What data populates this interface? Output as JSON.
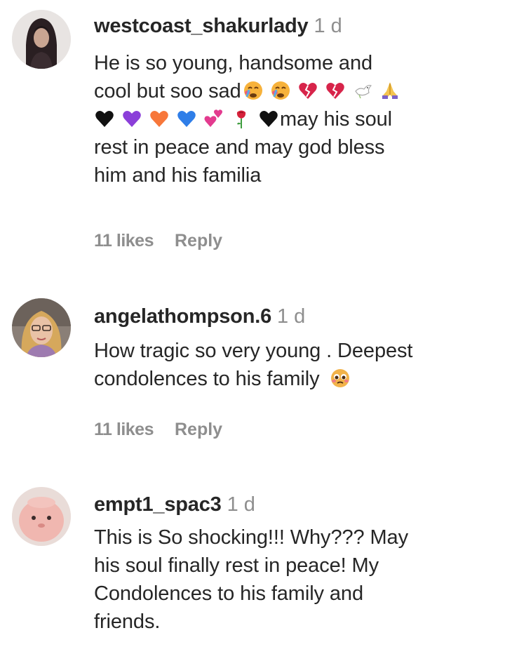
{
  "comments": [
    {
      "username": "westcoast_shakurlady",
      "time": "1 d",
      "avatar_icon": "profile-photo-dark-hair",
      "text_line_1": "He is so young, handsome and",
      "text_line_2": "cool but soo sad",
      "text_line_3_suffix": "may his soul",
      "text_line_4": "rest in peace and may god bless",
      "text_line_5": "him and his familia",
      "emojis_line_2": [
        "sad-face-emoji",
        "sad-face-emoji",
        "broken-heart-emoji",
        "broken-heart-emoji",
        "dove-emoji",
        "praying-hands-emoji"
      ],
      "emojis_line_3": [
        "black-heart-emoji",
        "purple-heart-emoji",
        "orange-heart-emoji",
        "blue-heart-emoji",
        "two-hearts-emoji",
        "rose-emoji",
        "black-heart-emoji"
      ],
      "likes": "11 likes",
      "reply": "Reply"
    },
    {
      "username": "angelathompson.6",
      "time": "1 d",
      "avatar_icon": "profile-photo-blonde-glasses",
      "text_line_1": "How tragic so very young . Deepest",
      "text_line_2": "condolences to his family",
      "emojis_line_2": [
        "pleading-face-emoji"
      ],
      "likes": "11 likes",
      "reply": "Reply"
    },
    {
      "username": "empt1_spac3",
      "time": "1 d",
      "avatar_icon": "profile-photo-pink-plush",
      "text_line_1": "This is So shocking!!! Why??? May",
      "text_line_2": "his soul finally rest in peace! My",
      "text_line_3": "Condolences to his family and",
      "text_line_4": "friends."
    }
  ],
  "colors": {
    "text": "#262626",
    "muted": "#8e8e8e",
    "background": "#ffffff"
  }
}
